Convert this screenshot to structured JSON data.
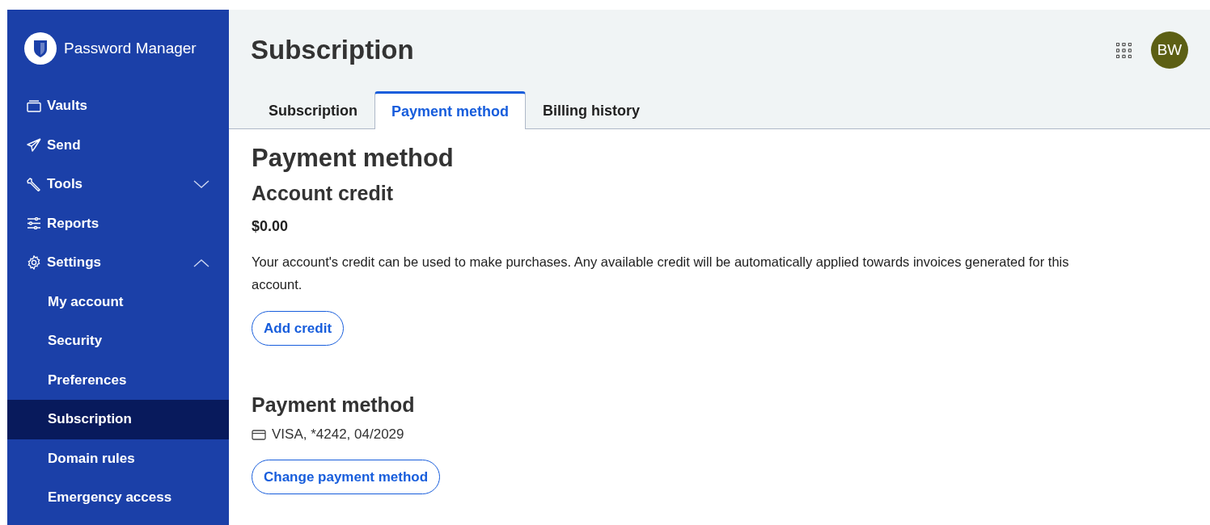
{
  "app": {
    "name": "Password Manager"
  },
  "sidebar": {
    "items": [
      {
        "label": "Vaults"
      },
      {
        "label": "Send"
      },
      {
        "label": "Tools",
        "expanded": false
      },
      {
        "label": "Reports"
      },
      {
        "label": "Settings",
        "expanded": true,
        "children": [
          {
            "label": "My account",
            "selected": false
          },
          {
            "label": "Security",
            "selected": false
          },
          {
            "label": "Preferences",
            "selected": false
          },
          {
            "label": "Subscription",
            "selected": true
          },
          {
            "label": "Domain rules",
            "selected": false
          },
          {
            "label": "Emergency access",
            "selected": false
          }
        ]
      }
    ]
  },
  "header": {
    "title": "Subscription",
    "avatar": "BW",
    "tabs": [
      {
        "label": "Subscription",
        "selected": false
      },
      {
        "label": "Payment method",
        "selected": true
      },
      {
        "label": "Billing history",
        "selected": false
      }
    ]
  },
  "content": {
    "title": "Payment method",
    "credit": {
      "heading": "Account credit",
      "amount": "$0.00",
      "description": "Your account's credit can be used to make purchases. Any available credit will be automatically applied towards invoices generated for this account.",
      "button": "Add credit"
    },
    "payment": {
      "heading": "Payment method",
      "card": "VISA, *4242, 04/2029",
      "button": "Change payment method"
    }
  }
}
